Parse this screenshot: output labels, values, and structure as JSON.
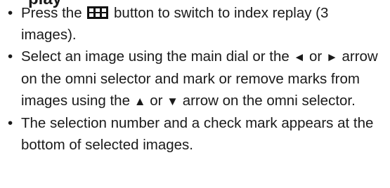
{
  "heading": {
    "partial_text": "play"
  },
  "bullets": [
    {
      "prefix": "Press the",
      "icon": "index-replay-icon",
      "suffix": "button to switch to index replay (3 images)."
    },
    {
      "part1": "Select an image using the main dial or the",
      "left_arrow": "◄",
      "part2": "or",
      "right_arrow": "►",
      "part3": "arrow on the omni selector and mark or remove marks from images using the",
      "up_arrow": "▲",
      "part4": "or",
      "down_arrow": "▼",
      "part5": "arrow on the omni selector."
    },
    {
      "text": "The selection number and a check mark appears at the bottom of selected images."
    }
  ],
  "bullet_glyph": "•"
}
